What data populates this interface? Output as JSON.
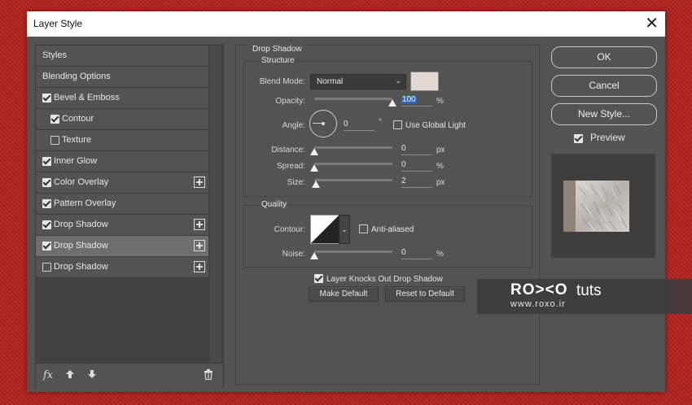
{
  "window": {
    "title": "Layer Style",
    "close_glyph": "✕"
  },
  "styles_list": [
    {
      "label": "Styles",
      "has_checkbox": false,
      "checked": false,
      "has_plus": false,
      "selected": false,
      "indent": false
    },
    {
      "label": "Blending Options",
      "has_checkbox": false,
      "checked": false,
      "has_plus": false,
      "selected": false,
      "indent": false
    },
    {
      "label": "Bevel & Emboss",
      "has_checkbox": true,
      "checked": true,
      "has_plus": false,
      "selected": false,
      "indent": false
    },
    {
      "label": "Contour",
      "has_checkbox": true,
      "checked": true,
      "has_plus": false,
      "selected": false,
      "indent": true
    },
    {
      "label": "Texture",
      "has_checkbox": true,
      "checked": false,
      "has_plus": false,
      "selected": false,
      "indent": true
    },
    {
      "label": "Inner Glow",
      "has_checkbox": true,
      "checked": true,
      "has_plus": false,
      "selected": false,
      "indent": false
    },
    {
      "label": "Color Overlay",
      "has_checkbox": true,
      "checked": true,
      "has_plus": true,
      "selected": false,
      "indent": false
    },
    {
      "label": "Pattern Overlay",
      "has_checkbox": true,
      "checked": true,
      "has_plus": false,
      "selected": false,
      "indent": false
    },
    {
      "label": "Drop Shadow",
      "has_checkbox": true,
      "checked": true,
      "has_plus": true,
      "selected": false,
      "indent": false
    },
    {
      "label": "Drop Shadow",
      "has_checkbox": true,
      "checked": true,
      "has_plus": true,
      "selected": true,
      "indent": false
    },
    {
      "label": "Drop Shadow",
      "has_checkbox": true,
      "checked": false,
      "has_plus": true,
      "selected": false,
      "indent": false
    }
  ],
  "left_footer": {
    "fx_label": "fx",
    "icons": [
      "fx-icon",
      "move-up-icon",
      "move-down-icon",
      "trash-icon"
    ]
  },
  "drop_shadow": {
    "section_title": "Drop Shadow",
    "structure_title": "Structure",
    "blend_mode_label": "Blend Mode:",
    "blend_mode_value": "Normal",
    "shadow_color": "#e3d8d2",
    "opacity_label": "Opacity:",
    "opacity_value": "100",
    "opacity_unit": "%",
    "opacity_level": 1.0,
    "angle_label": "Angle:",
    "angle_value": "0",
    "angle_unit": "°",
    "global_light_label": "Use Global Light",
    "global_light_checked": false,
    "distance_label": "Distance:",
    "distance_value": "0",
    "distance_unit": "px",
    "spread_label": "Spread:",
    "spread_value": "0",
    "spread_unit": "%",
    "size_label": "Size:",
    "size_value": "2",
    "size_unit": "px",
    "quality_title": "Quality",
    "contour_label": "Contour:",
    "anti_aliased_label": "Anti-aliased",
    "anti_aliased_checked": false,
    "noise_label": "Noise:",
    "noise_value": "0",
    "noise_unit": "%",
    "knockout_label": "Layer Knocks Out Drop Shadow",
    "knockout_checked": true,
    "make_default_label": "Make Default",
    "reset_default_label": "Reset to Default"
  },
  "actions": {
    "ok_label": "OK",
    "cancel_label": "Cancel",
    "new_style_label": "New Style...",
    "preview_label": "Preview",
    "preview_checked": true
  },
  "watermark": {
    "brand": "RO><O",
    "tuts": "tuts",
    "site": "www.roxo.ir"
  }
}
